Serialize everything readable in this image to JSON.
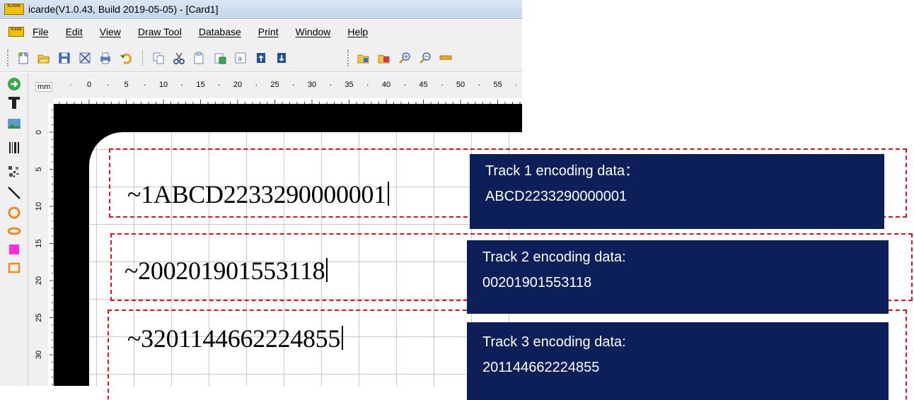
{
  "window": {
    "title": "icarde(V1.0.43, Build 2019-05-05) - [Card1]",
    "logo_text": "ICARE"
  },
  "menu": [
    "File",
    "Edit",
    "View",
    "Draw Tool",
    "Database",
    "Print",
    "Window",
    "Help"
  ],
  "toolbar_icons": [
    "new-icon",
    "open-icon",
    "save-icon",
    "close-icon",
    "print-icon",
    "undo-icon",
    "copy-icon",
    "cut-icon",
    "paste-icon",
    "paste-special-icon",
    "insert-icon",
    "align-top-icon",
    "align-bottom-icon",
    "folder-icon",
    "image-icon",
    "zoom-in-icon",
    "zoom-out-icon",
    "ruler-icon"
  ],
  "tools": [
    "go-icon",
    "text-tool-icon",
    "image-tool-icon",
    "barcode-tool-icon",
    "qrcode-tool-icon",
    "line-tool-icon",
    "circle-tool-icon",
    "ellipse-tool-icon",
    "fill-rect-tool-icon",
    "rect-tool-icon"
  ],
  "ruler": {
    "unit": "mm",
    "top_labels": [
      "0",
      "5",
      "10",
      "15",
      "20",
      "25",
      "30",
      "35",
      "40",
      "45",
      "50",
      "55"
    ],
    "left_labels": [
      "0",
      "5",
      "10",
      "15",
      "20",
      "25",
      "30"
    ]
  },
  "tracks": [
    {
      "text": "~1ABCD2233290000001",
      "label": "Track 1 encoding data：",
      "value": "ABCD2233290000001"
    },
    {
      "text": "~200201901553118",
      "label": "Track 2 encoding data:",
      "value": "00201901553118"
    },
    {
      "text": "~3201144662224855",
      "label": "Track 3 encoding data:",
      "value": "201144662224855"
    }
  ],
  "colors": {
    "frame": "#e0101a",
    "info_bg": "#0c1f58",
    "canvas_bg": "#000000"
  }
}
